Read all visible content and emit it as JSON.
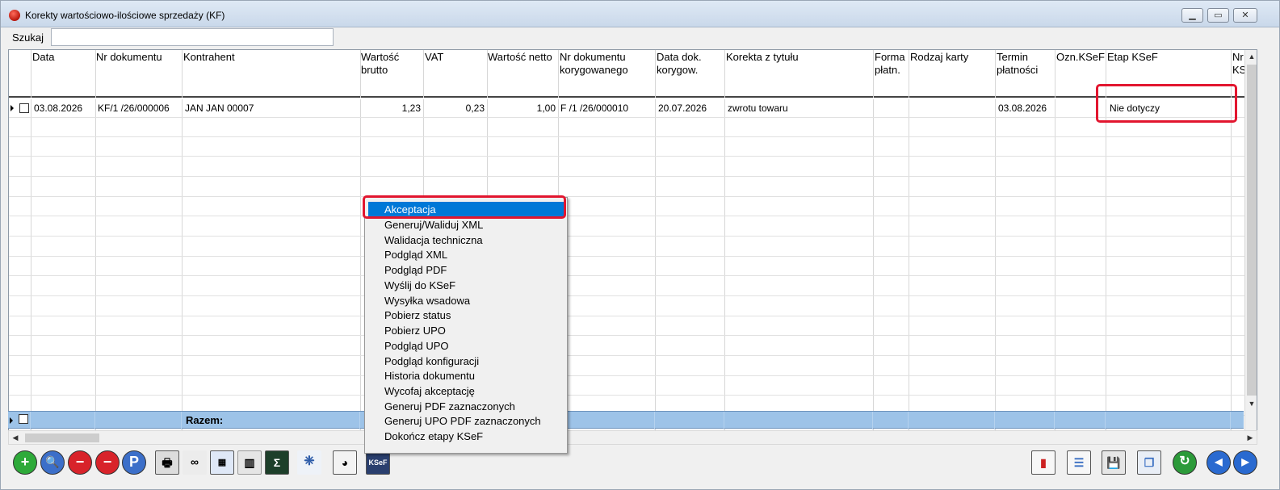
{
  "window": {
    "title": "Korekty wartościowo-ilościowe sprzedaży (KF)",
    "controls": [
      "minimize",
      "maximize",
      "close"
    ]
  },
  "search": {
    "label": "Szukaj",
    "value": ""
  },
  "table": {
    "columns": [
      "Data",
      "Nr dokumentu",
      "Kontrahent",
      "Wartość\nbrutto",
      "VAT",
      "Wartość netto",
      "Nr dokumentu\nkorygowanego",
      "Data dok.\nkorygow.",
      "Korekta z tytułu",
      "Forma\npłatn.",
      "Rodzaj karty",
      "Termin\npłatności",
      "Ozn.KSeF",
      "Etap KSeF",
      "Nr\nKS"
    ],
    "rows": [
      {
        "data": "03.08.2026",
        "nr_dokumentu": "KF/1  /26/000006",
        "kontrahent": "JAN JAN 00007",
        "wartosc_brutto": "1,23",
        "vat": "0,23",
        "wartosc_netto": "1,00",
        "nr_dok_korygowanego": "F /1  /26/000010",
        "data_dok_korygow": "20.07.2026",
        "korekta_z_tytulu": "zwrotu towaru",
        "forma_platn": "",
        "rodzaj_karty": "",
        "termin_platnosci": "03.08.2026",
        "ozn_ksef": "",
        "etap_ksef": "Nie dotyczy"
      }
    ],
    "summary_label": "Razem:"
  },
  "context_menu": {
    "items": [
      "Akceptacja",
      "Generuj/Waliduj XML",
      "Walidacja techniczna",
      "Podgląd XML",
      "Podgląd PDF",
      "Wyślij do KSeF",
      "Wysyłka wsadowa",
      "Pobierz status",
      "Pobierz UPO",
      "Podgląd UPO",
      "Podgląd konfiguracji",
      "Historia dokumentu",
      "Wycofaj akceptację",
      "Generuj PDF zaznaczonych",
      "Generuj UPO PDF zaznaczonych",
      "Dokończ etapy KSeF"
    ],
    "selected": "Akceptacja"
  },
  "toolbar": {
    "icons": [
      "add-icon",
      "preview-icon",
      "delete-icon",
      "delete-selected-icon",
      "p-icon",
      "print-icon",
      "binoculars-icon",
      "calendar-table-icon",
      "archive-icon",
      "sum-icon",
      "group-icon",
      "chart-window-icon",
      "ksef-icon",
      "report-chart-icon",
      "document-icon",
      "save-icon",
      "windows-icon",
      "refresh-icon",
      "prev-icon",
      "next-icon"
    ],
    "ksef_label": "KSeF",
    "p_label": "P"
  },
  "colors": {
    "selection": "#0078d7",
    "highlight_box": "#e2162f",
    "summary_row": "#9dc3e8"
  }
}
